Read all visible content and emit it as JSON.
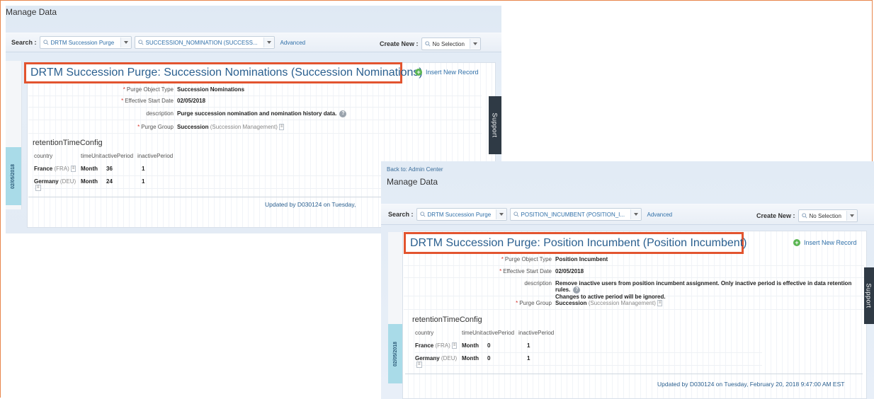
{
  "screen1": {
    "page_title": "Manage Data",
    "search": {
      "label": "Search :",
      "object_type_value": "DRTM Succession Purge",
      "object_value": "SUCCESSION_NOMINATION (SUCCESS...",
      "advanced_link": "Advanced"
    },
    "create_new": {
      "label": "Create New :",
      "value": "No Selection"
    },
    "record_title": "DRTM Succession Purge: Succession Nominations (Succession Nominations)",
    "insert_new_record": "Insert New Record",
    "fields": [
      {
        "label": "Purge Object Type",
        "required": "*",
        "value": "Succession Nominations",
        "sub": ""
      },
      {
        "label": "Effective Start Date",
        "required": "*",
        "value": "02/05/2018",
        "sub": ""
      },
      {
        "label": "description",
        "required": "",
        "value": "Purge succession nomination and nomination history data.",
        "sub": ""
      },
      {
        "label": "Purge Group",
        "required": "*",
        "value": "Succession",
        "sub": "(Succession Management)"
      }
    ],
    "section_title": "retentionTimeConfig",
    "table": {
      "headers": [
        "country",
        "timeUnit",
        "activePeriod",
        "inactivePeriod"
      ],
      "rows": [
        {
          "country": "France",
          "country_code": "(FRA)",
          "timeUnit": "Month",
          "activePeriod": "36",
          "inactivePeriod": "1"
        },
        {
          "country": "Germany",
          "country_code": "(DEU)",
          "timeUnit": "Month",
          "activePeriod": "24",
          "inactivePeriod": "1"
        }
      ]
    },
    "timeline_date": "02/05/2018",
    "updated_by": "Updated by D030124 on Tuesday,",
    "support_tab": "Support"
  },
  "screen2": {
    "back_link": "Back to: Admin Center",
    "page_title": "Manage Data",
    "search": {
      "label": "Search :",
      "object_type_value": "DRTM Succession Purge",
      "object_value": "POSITION_INCUMBENT (POSITION_I...",
      "advanced_link": "Advanced"
    },
    "create_new": {
      "label": "Create New :",
      "value": "No Selection"
    },
    "record_title": "DRTM Succession Purge: Position Incumbent (Position Incumbent)",
    "insert_new_record": "Insert New Record",
    "fields": [
      {
        "label": "Purge Object Type",
        "required": "*",
        "value": "Position Incumbent",
        "sub": ""
      },
      {
        "label": "Effective Start Date",
        "required": "*",
        "value": "02/05/2018",
        "sub": ""
      },
      {
        "label": "description",
        "required": "",
        "value": "Remove inactive users from position incumbent assignment. Only inactive period is effective in data retention rules.",
        "value2": "Changes to active period will be ignored.",
        "sub": ""
      },
      {
        "label": "Purge Group",
        "required": "*",
        "value": "Succession",
        "sub": "(Succession Management)"
      }
    ],
    "section_title": "retentionTimeConfig",
    "table": {
      "headers": [
        "country",
        "timeUnit",
        "activePeriod",
        "inactivePeriod"
      ],
      "rows": [
        {
          "country": "France",
          "country_code": "(FRA)",
          "timeUnit": "Month",
          "activePeriod": "0",
          "inactivePeriod": "1"
        },
        {
          "country": "Germany",
          "country_code": "(DEU)",
          "timeUnit": "Month",
          "activePeriod": "0",
          "inactivePeriod": "1"
        }
      ]
    },
    "timeline_date": "02/05/2018",
    "updated_by": "Updated by D030124 on Tuesday, February 20, 2018 9:47:00 AM EST",
    "support_tab": "Support"
  },
  "icons": {
    "search": "magnifier-icon",
    "dropdown": "chevron-down-icon",
    "add": "plus-circle-icon",
    "help": "help-icon",
    "value_help": "value-help-icon"
  },
  "colors": {
    "highlight_border": "#e2542f",
    "link": "#2f6fa8",
    "title": "#2a5f8f",
    "timeline": "#a9dbe8",
    "support": "#2f3a45",
    "add_icon": "#5ab552",
    "frame_border": "#e8864b"
  }
}
